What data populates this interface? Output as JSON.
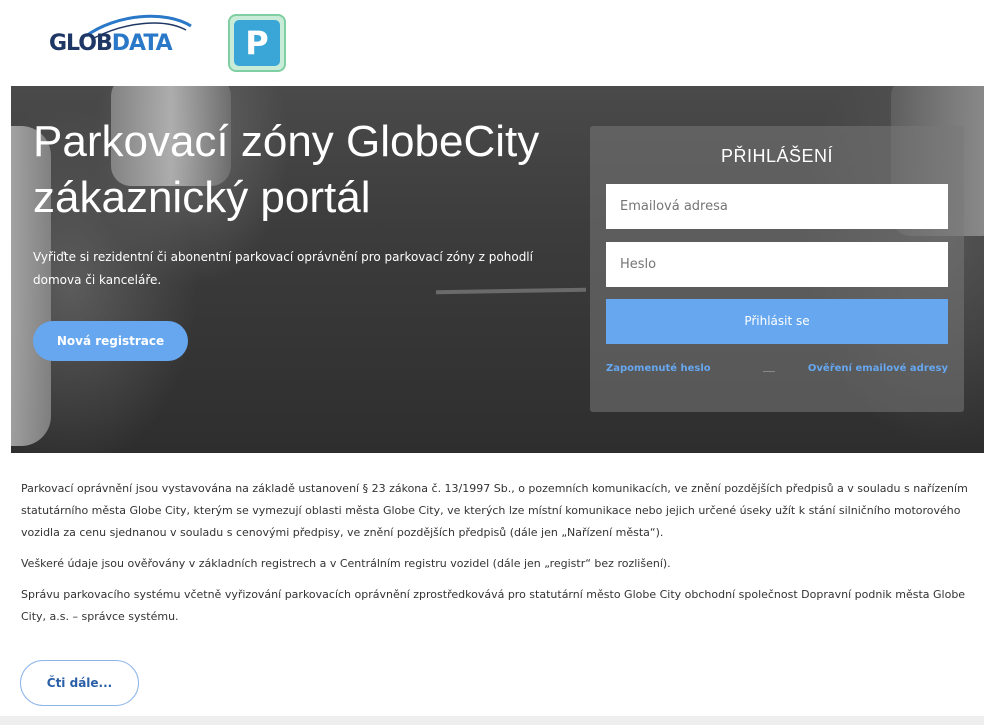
{
  "header": {
    "logo_globdata_part1": "GLOB",
    "logo_globdata_part2": "DATA",
    "logo_parking_letter": "P"
  },
  "hero": {
    "title": "Parkovací zóny GlobeCity zákaznický portál",
    "subtitle": "Vyřiďte si rezidentní či abonentní parkovací oprávnění pro parkovací zóny z pohodlí domova či kanceláře.",
    "register_button": "Nová registrace"
  },
  "login": {
    "title": "PŘIHLÁŠENÍ",
    "email_placeholder": "Emailová adresa",
    "password_placeholder": "Heslo",
    "submit_button": "Přihlásit se",
    "forgot_password_link": "Zapomenuté heslo",
    "verify_email_link": "Ověření emailové adresy"
  },
  "content": {
    "paragraphs": [
      "Parkovací oprávnění jsou vystavována na základě ustanovení § 23 zákona č. 13/1997 Sb., o pozemních komunikacích, ve znění pozdějších předpisů a v souladu s nařízením statutárního města Globe City, kterým se vymezují oblasti města Globe City, ve kterých lze místní komunikace nebo jejich určené úseky užít k stání silničního motorového vozidla za cenu sjednanou v souladu s cenovými předpisy, ve znění pozdějších předpisů (dále jen „Nařízení města“).",
      "Veškeré údaje jsou ověřovány v základních registrech a v Centrálním registru vozidel (dále jen „registr“ bez rozlišení).",
      "Správu parkovacího systému včetně vyřizování parkovacích oprávnění zprostředkovává pro statutární město Globe City obchodní společnost Dopravní podnik města Globe City, a.s. – správce systému."
    ],
    "read_more_button": "Čti dále..."
  },
  "colors": {
    "accent_blue": "#66a7f0",
    "logo_navy": "#1e3764",
    "logo_blue": "#2a78c8"
  }
}
